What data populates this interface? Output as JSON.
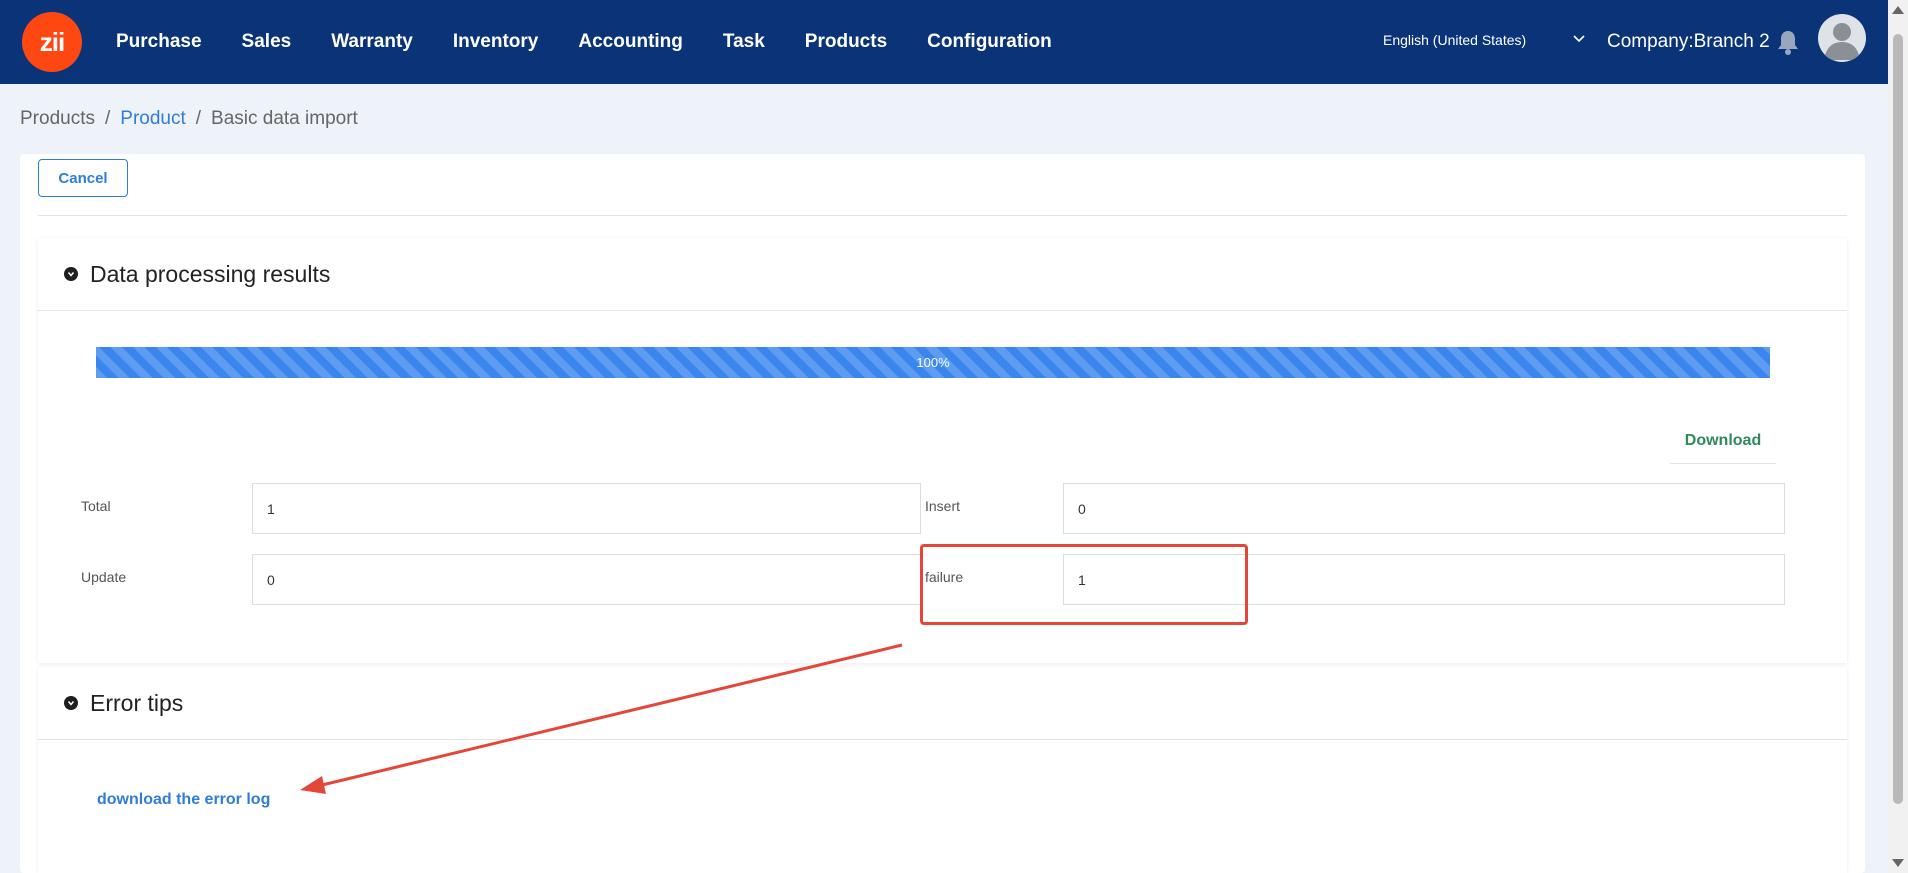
{
  "header": {
    "logo_text": "zii",
    "nav": [
      "Purchase",
      "Sales",
      "Warranty",
      "Inventory",
      "Accounting",
      "Task",
      "Products",
      "Configuration"
    ],
    "language": "English (United States)",
    "company": "Company:Branch 2"
  },
  "breadcrumb": {
    "items": [
      "Products",
      "Product",
      "Basic data import"
    ],
    "separator": "/"
  },
  "toolbar": {
    "cancel_label": "Cancel"
  },
  "results": {
    "title": "Data processing results",
    "progress_percent": 100,
    "progress_label": "100%",
    "download_label": "Download",
    "fields": {
      "total_label": "Total",
      "total_value": "1",
      "insert_label": "Insert",
      "insert_value": "0",
      "update_label": "Update",
      "update_value": "0",
      "failure_label": "failure",
      "failure_value": "1"
    }
  },
  "errors": {
    "title": "Error tips",
    "link_label": "download the error log"
  },
  "colors": {
    "topbar": "#0b3478",
    "logo": "#ff4712",
    "accent": "#2f7dd9",
    "progress": "#3a86ee",
    "download": "#2e8b57",
    "annotation": "#e5463a"
  },
  "icons": [
    "logo",
    "chevron-down-icon",
    "bell-icon",
    "avatar-icon",
    "collapse-icon"
  ]
}
